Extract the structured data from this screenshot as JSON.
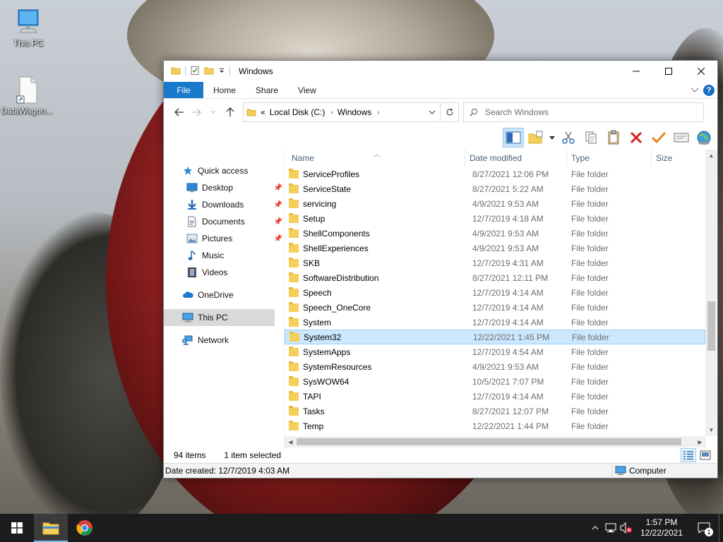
{
  "desktop": {
    "icons": [
      {
        "label": "This PC"
      },
      {
        "label": "DataWagon..."
      }
    ]
  },
  "window": {
    "title": "Windows",
    "ribbon": {
      "file": "File",
      "home": "Home",
      "share": "Share",
      "view": "View",
      "help": "?"
    },
    "address": {
      "overflow": "«",
      "crumbs": [
        "Local Disk (C:)",
        "Windows"
      ]
    },
    "search": {
      "placeholder": "Search Windows"
    },
    "navpane": {
      "quick_access": "Quick access",
      "desktop": "Desktop",
      "downloads": "Downloads",
      "documents": "Documents",
      "pictures": "Pictures",
      "music": "Music",
      "videos": "Videos",
      "onedrive": "OneDrive",
      "this_pc": "This PC",
      "network": "Network"
    },
    "columns": {
      "name": "Name",
      "date": "Date modified",
      "type": "Type",
      "size": "Size"
    },
    "rows": [
      {
        "name": "ServiceProfiles",
        "date": "8/27/2021 12:06 PM",
        "type": "File folder"
      },
      {
        "name": "ServiceState",
        "date": "8/27/2021 5:22 AM",
        "type": "File folder"
      },
      {
        "name": "servicing",
        "date": "4/9/2021 9:53 AM",
        "type": "File folder"
      },
      {
        "name": "Setup",
        "date": "12/7/2019 4:18 AM",
        "type": "File folder"
      },
      {
        "name": "ShellComponents",
        "date": "4/9/2021 9:53 AM",
        "type": "File folder"
      },
      {
        "name": "ShellExperiences",
        "date": "4/9/2021 9:53 AM",
        "type": "File folder"
      },
      {
        "name": "SKB",
        "date": "12/7/2019 4:31 AM",
        "type": "File folder"
      },
      {
        "name": "SoftwareDistribution",
        "date": "8/27/2021 12:11 PM",
        "type": "File folder"
      },
      {
        "name": "Speech",
        "date": "12/7/2019 4:14 AM",
        "type": "File folder"
      },
      {
        "name": "Speech_OneCore",
        "date": "12/7/2019 4:14 AM",
        "type": "File folder"
      },
      {
        "name": "System",
        "date": "12/7/2019 4:14 AM",
        "type": "File folder"
      },
      {
        "name": "System32",
        "date": "12/22/2021 1:45 PM",
        "type": "File folder"
      },
      {
        "name": "SystemApps",
        "date": "12/7/2019 4:54 AM",
        "type": "File folder"
      },
      {
        "name": "SystemResources",
        "date": "4/9/2021 9:53 AM",
        "type": "File folder"
      },
      {
        "name": "SysWOW64",
        "date": "10/5/2021 7:07 PM",
        "type": "File folder"
      },
      {
        "name": "TAPI",
        "date": "12/7/2019 4:14 AM",
        "type": "File folder"
      },
      {
        "name": "Tasks",
        "date": "8/27/2021 12:07 PM",
        "type": "File folder"
      },
      {
        "name": "Temp",
        "date": "12/22/2021 1:44 PM",
        "type": "File folder"
      }
    ],
    "selected_row": "System32",
    "status": {
      "item_count": "94 items",
      "selection": "1 item selected",
      "details": "Date created: 12/7/2019 4:03 AM",
      "location": "Computer"
    }
  },
  "taskbar": {
    "clock_time": "1:57 PM",
    "clock_date": "12/22/2021",
    "notification_count": "1"
  },
  "colors": {
    "accent": "#1979ca",
    "selection": "#cce8ff",
    "taskbar": "#1c1c1c",
    "folder": "#f5cf5a"
  }
}
